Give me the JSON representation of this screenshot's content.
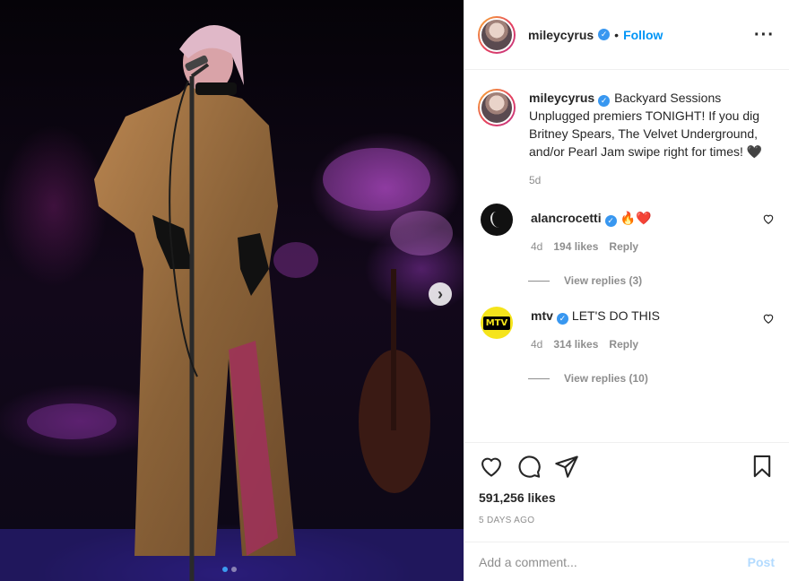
{
  "post": {
    "username": "mileycyrus",
    "separator": "•",
    "follow_label": "Follow",
    "more_icon": "more-horizontal-icon"
  },
  "caption": {
    "username": "mileycyrus",
    "text": "Backyard Sessions Unplugged premiers TONIGHT! If you dig Britney Spears, The Velvet Underground, and/or Pearl Jam swipe right for times! 🖤",
    "age": "5d"
  },
  "comments": [
    {
      "username": "alancrocetti",
      "text": "🔥❤️",
      "age": "4d",
      "likes": "194 likes",
      "reply_label": "Reply",
      "view_replies": "View replies (3)"
    },
    {
      "username": "mtv",
      "text": "LET'S DO THIS",
      "age": "4d",
      "likes": "314 likes",
      "reply_label": "Reply",
      "view_replies": "View replies (10)"
    }
  ],
  "mtv_logo_text": "MTV",
  "carousel": {
    "next_glyph": "›",
    "slide_count": 2,
    "active_index": 0
  },
  "actions": {
    "likes": "591,256 likes",
    "date": "5 DAYS AGO",
    "icons": [
      "heart-icon",
      "comment-icon",
      "share-icon",
      "bookmark-icon"
    ]
  },
  "add_comment": {
    "placeholder": "Add a comment...",
    "post_label": "Post"
  },
  "colors": {
    "link_blue": "#0095f6",
    "verified_blue": "#3897f0",
    "post_disabled": "#b3dbff",
    "muted": "#8e8e8e"
  }
}
